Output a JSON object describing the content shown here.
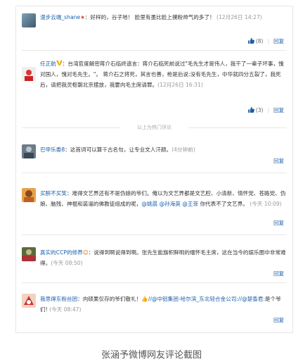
{
  "comments": [
    {
      "user": "漫步云端_shane",
      "text": "：好样的，谷子地！ 脸里有墨比脸上撲粉帅气的多了！",
      "time": "(12月26日 14:27)",
      "likes": "(8)",
      "reply": "回复"
    },
    {
      "user": "任正航",
      "text": "：台湾官度解密蒋介石临终遗言：蒋介石临死前说过\"毛先生才是伟人，我干了一辈子坏事，愧对国人，愧对毛先生。\"。 蒋介石之将死，其言也善，枪是后说:没有毛先生，中华就四分五裂了，我死后，请把我灵枢朝北京摆放，我要向毛主席请罪。",
      "time": "(12月26日 16:31)",
      "likes": "(3)",
      "reply": "回复"
    },
    {
      "user": "巴甲乐委8",
      "text": "：这首词可以算千古名句，让专业文人汗颜。",
      "time": "(4分钟前)",
      "likes": "",
      "reply": "回复"
    }
  ],
  "divider": "以上为热门评论",
  "replies": [
    {
      "user": "买醉不买笑",
      "text": "：难得文艺界还有不是伪娘的爷们。俺以为文艺界都是文艺腔、小清新、情怀党、苍路党、伪娘、脑残、神棍和装逼的佛教徒组成的呢，",
      "mentions": "@姚晨 @孙海英 @王菲",
      "tail": "你代表不了文艺界。",
      "time": "(今天 10:09)",
      "reply": "回复"
    },
    {
      "user": "真实的CCP的修养",
      "text": "：说得到啊说得到啊。张先生能旗帜鲜明的缅怀毛主席，这在当今的娱乐圈中非常难得。",
      "time": "(今天 08:50)",
      "reply": "回复"
    },
    {
      "user": "我思得东粉丝团",
      "text": "：向硕果仅存的爷们敬礼！",
      "mentions": "//@中铝集团-哈尔滨_东北轻合金公司://@楚香君:",
      "tail": "是个爷们!",
      "time": "(今天 08:47)",
      "reply": "回复"
    }
  ],
  "caption": "张涵予微博网友评论截图"
}
